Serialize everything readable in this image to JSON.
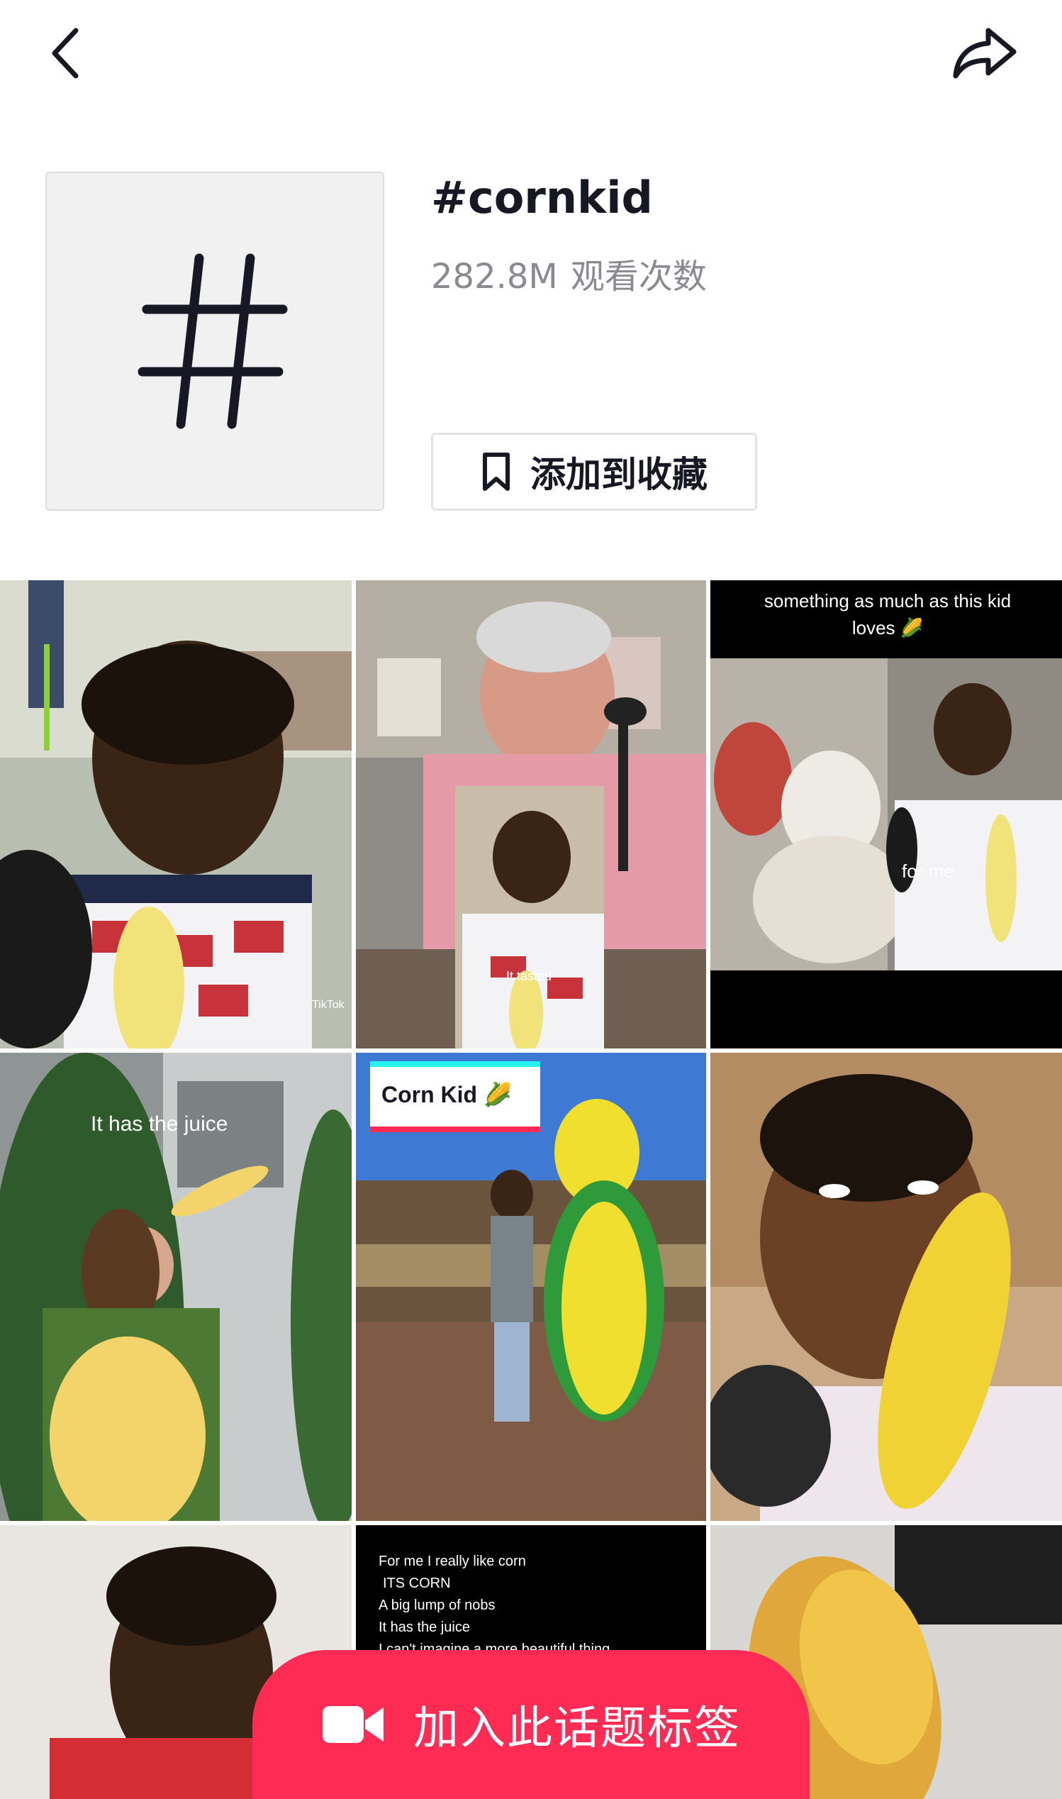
{
  "header": {
    "back_icon": "chevron-left-icon",
    "share_icon": "share-arrow-icon"
  },
  "hashtag": {
    "cover_icon": "hash-icon",
    "title": "#cornkid",
    "views_count": "282.8M",
    "views_label": "观看次数",
    "favorite_icon": "bookmark-icon",
    "favorite_label": "添加到收藏"
  },
  "videos": [
    {
      "caption": "",
      "watermark": "TikTok"
    },
    {
      "caption": "It tasted",
      "watermark": ""
    },
    {
      "caption": "something as much as this kid loves 🌽",
      "overlay": "for me"
    },
    {
      "caption": "It has the juice"
    },
    {
      "caption": "Corn Kid 🌽"
    },
    {
      "caption": ""
    },
    {
      "caption": ""
    },
    {
      "caption_lines": [
        "For me I really like corn",
        "ITS CORN",
        "A big lump of nobs",
        "It has the juice",
        "I can't imagine a more beautiful thing"
      ]
    },
    {
      "caption": ""
    }
  ],
  "join": {
    "icon": "video-camera-icon",
    "label": "加入此话题标签"
  },
  "colors": {
    "accent": "#fe2c55",
    "text_primary": "#161823",
    "text_secondary": "#8a8b91"
  }
}
